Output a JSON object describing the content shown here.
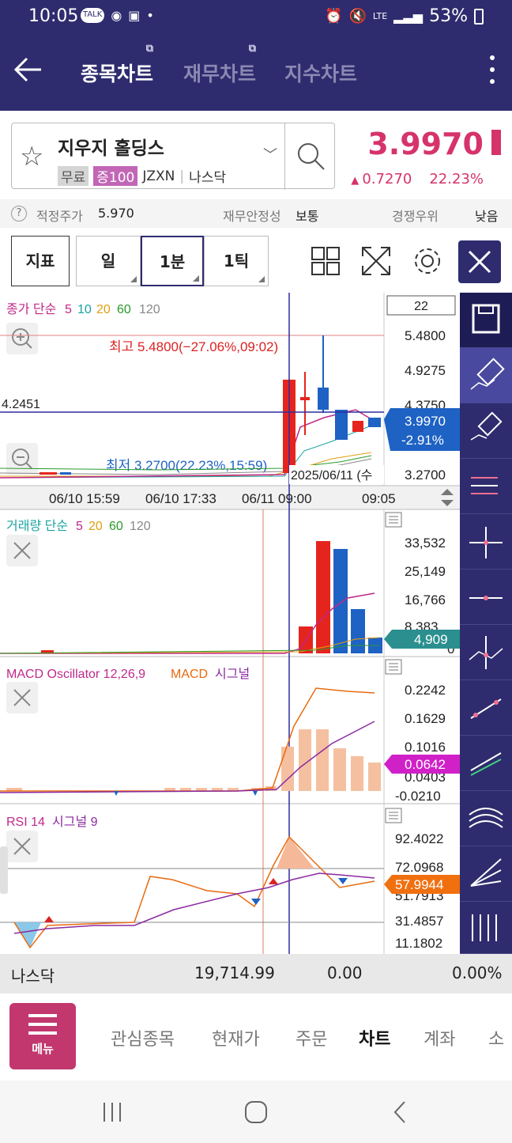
{
  "status": {
    "time": "10:05",
    "battery": "53%",
    "lte": "LTE"
  },
  "header": {
    "tabs": [
      {
        "label": "종목차트"
      },
      {
        "label": "재무차트"
      },
      {
        "label": "지수차트"
      }
    ]
  },
  "stock": {
    "name": "지우지 홀딩스",
    "tag_free": "무료",
    "tag_margin": "증100",
    "ticker": "JZXN",
    "market": "나스닥",
    "price": "3.9970",
    "change": "0.7270",
    "change_pct": "22.23%"
  },
  "info": {
    "fair_label": "적정주가",
    "fair_value": "5.970",
    "fin_label": "재무안정성",
    "fin_value": "보통",
    "comp_label": "경쟁우위",
    "comp_value": "낮음"
  },
  "toolbar": {
    "indicator": "지표",
    "day": "일",
    "min1": "1분",
    "tick1": "1틱"
  },
  "chart": {
    "price_legend_title": "종가 단순",
    "price_legend": [
      "5",
      "10",
      "20",
      "60",
      "120"
    ],
    "period_box": "22",
    "price_axis": [
      "5.4800",
      "4.9275",
      "4.3750",
      "3.2700"
    ],
    "current_price": "3.9970",
    "current_pct": "-2.91%",
    "crosshair_value": "4.2451",
    "high_label": "최고 5.4800(−27.06%,09:02)",
    "low_label": "최저 3.2700(22.23%,15:59)",
    "date_tip": "2025/06/11 (수",
    "time_axis": [
      "06/10 15:59",
      "06/10 17:33",
      "06/11 09:00",
      "09:05"
    ],
    "volume_legend_title": "거래량 단순",
    "volume_legend": [
      "5",
      "20",
      "60",
      "120"
    ],
    "volume_axis": [
      "33,532",
      "25,149",
      "16,766",
      "8,383",
      "0"
    ],
    "volume_current": "4,909",
    "macd_legend_a": "MACD Oscillator 12,26,9",
    "macd_legend_b": "MACD",
    "macd_legend_c": "시그널",
    "macd_axis": [
      "0.2242",
      "0.1629",
      "0.1016",
      "0.0403",
      "-0.0210"
    ],
    "macd_current": "0.0642",
    "rsi_legend_a": "RSI 14",
    "rsi_legend_b": "시그널 9",
    "rsi_axis": [
      "92.4022",
      "72.0968",
      "51.7913",
      "31.4857",
      "11.1802"
    ],
    "rsi_current": "57.9944"
  },
  "chart_data": {
    "type": "candlestick",
    "title": "",
    "candles": [
      {
        "time": "09:00",
        "open": 4.9,
        "high": 4.95,
        "low": 3.3,
        "close": 3.3
      },
      {
        "time": "09:01",
        "open": 4.375,
        "high": 4.45,
        "low": 3.8,
        "close": 4.3
      },
      {
        "time": "09:02",
        "open": 4.6,
        "high": 5.48,
        "low": 4.0,
        "close": 4.35
      },
      {
        "time": "09:03",
        "open": 4.3,
        "high": 4.32,
        "low": 3.85,
        "close": 3.88
      },
      {
        "time": "09:04",
        "open": 3.95,
        "high": 4.08,
        "low": 3.8,
        "close": 4.1
      },
      {
        "time": "09:05",
        "open": 4.1,
        "high": 4.12,
        "low": 3.95,
        "close": 3.997
      }
    ],
    "volume": [
      5200,
      7200,
      33500,
      31000,
      12500,
      4909
    ],
    "macd_osc": [
      0.1,
      0.15,
      0.15,
      0.11,
      0.08,
      0.0642
    ],
    "rsi": [
      92.4,
      80,
      72,
      60,
      55,
      57.99
    ],
    "ylim_price": [
      3.27,
      5.48
    ],
    "ylim_volume": [
      0,
      33532
    ],
    "ylim_macd": [
      -0.021,
      0.2242
    ],
    "ylim_rsi": [
      11.1802,
      92.4022
    ]
  },
  "index_bar": {
    "name": "나스닥",
    "value": "19,714.99",
    "change": "0.00",
    "pct": "0.00%"
  },
  "nav": {
    "menu": "메뉴",
    "items": [
      "관심종목",
      "현재가",
      "주문",
      "차트",
      "계좌",
      "소"
    ]
  }
}
